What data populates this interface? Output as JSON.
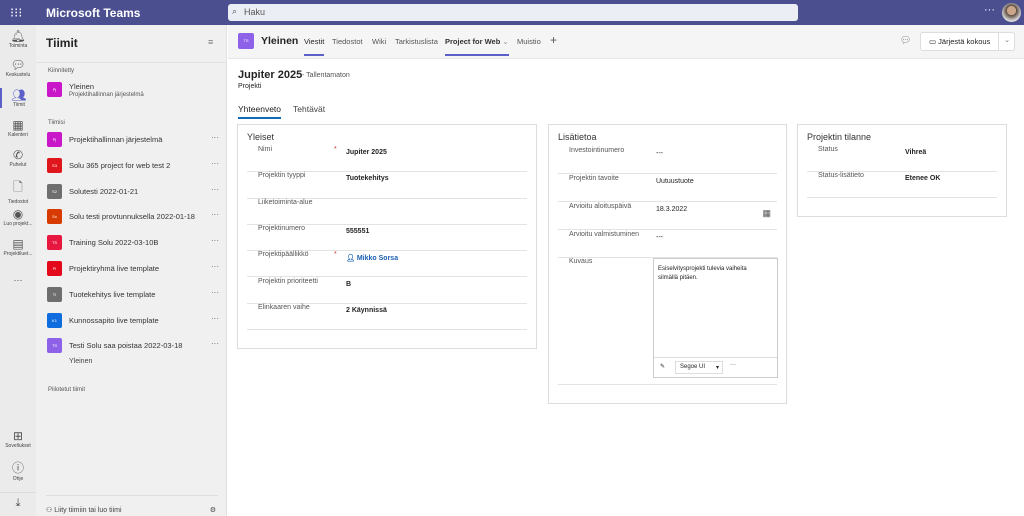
{
  "app": {
    "title": "Microsoft Teams",
    "search_placeholder": "Haku",
    "more": "···"
  },
  "rail": [
    {
      "label": "Toiminta",
      "icon": "bell"
    },
    {
      "label": "Keskustelu",
      "icon": "chat"
    },
    {
      "label": "Tiimit",
      "icon": "teams"
    },
    {
      "label": "Kalenteri",
      "icon": "calendar"
    },
    {
      "label": "Puhelut",
      "icon": "phone"
    },
    {
      "label": "Tiedostot",
      "icon": "file"
    },
    {
      "label": "Luo projekt...",
      "icon": "app"
    },
    {
      "label": "Projektiluet...",
      "icon": "app2"
    },
    {
      "label": "Sovellukset",
      "icon": "apps"
    },
    {
      "label": "Ohje",
      "icon": "help"
    }
  ],
  "teams_panel": {
    "title": "Tiimit",
    "pinned_label": "Kiinnitetty",
    "pinned": {
      "name": "Yleinen",
      "sub": "Projektihallinnan järjestelmä",
      "initials": "Pj",
      "color": "#c916c9"
    },
    "my_label": "Tiimisi",
    "teams": [
      {
        "initials": "Pj",
        "name": "Projektihallinnan järjestelmä",
        "color": "#c916c9"
      },
      {
        "initials": "S3",
        "name": "Solu 365 project for web test 2",
        "color": "#e0161d"
      },
      {
        "initials": "S2",
        "name": "Solutesti 2022-01-21",
        "color": "#6e6e6e"
      },
      {
        "initials": "Sx",
        "name": "Solu testi provtunnuksella 2022-01-18",
        "color": "#d83b01"
      },
      {
        "initials": "TS",
        "name": "Training Solu 2022-03-10B",
        "color": "#e81740"
      },
      {
        "initials": "PI",
        "name": "Projektiryhmä live template",
        "color": "#e3081a"
      },
      {
        "initials": "TI",
        "name": "Tuotekehitys live template",
        "color": "#6e6e6e"
      },
      {
        "initials": "K1",
        "name": "Kunnossapito live template",
        "color": "#0f6cde"
      },
      {
        "initials": "TS",
        "name": "Testi Solu saa poistaa 2022-03-18",
        "color": "#8e62e8"
      }
    ],
    "channel": "Yleinen",
    "hidden_label": "Piilotetut tiimit",
    "join": "Liity tiimiin tai luo tiimi"
  },
  "channel_header": {
    "badge": "TS",
    "name": "Yleinen",
    "tabs": [
      "Viestit",
      "Tiedostot",
      "Wiki",
      "Tarkistuslista",
      "Project for Web",
      "Muistio"
    ],
    "add": "+",
    "meet": "Järjestä kokous"
  },
  "project": {
    "title": "Jupiter 2025",
    "state": "- Tallentamaton",
    "type": "Projekti",
    "subtabs": [
      "Yhteenveto",
      "Tehtävät"
    ]
  },
  "general": {
    "title": "Yleiset",
    "fields": [
      {
        "label": "Nimi",
        "value": "Jupiter 2025",
        "required": "*"
      },
      {
        "label": "Projektin tyyppi",
        "value": "Tuotekehitys"
      },
      {
        "label": "Liiketoiminta-alue",
        "value": ""
      },
      {
        "label": "Projektinumero",
        "value": "555551"
      },
      {
        "label": "Projektipäällikkö",
        "value": "Mikko Sorsa",
        "required": "*"
      },
      {
        "label": "Projektin prioriteetti",
        "value": "B"
      },
      {
        "label": "Elinkaaren vaihe",
        "value": "2 Käynnissä"
      }
    ]
  },
  "extra": {
    "title": "Lisätietoa",
    "fields": [
      {
        "label": "Investointinumero",
        "value": "---"
      },
      {
        "label": "Projektin tavoite",
        "value": "Uutuustuote"
      },
      {
        "label": "Arvioitu aloituspäivä",
        "value": "18.3.2022"
      },
      {
        "label": "Arvioitu valmistuminen",
        "value": "---"
      }
    ],
    "desc_label": "Kuvaus",
    "desc": "Esiselvitysprojekti tulevia vaiheita silmällä pitäen.",
    "font": "Segoe UI",
    "more": "···"
  },
  "status": {
    "title": "Projektin tilanne",
    "fields": [
      {
        "label": "Status",
        "value": "Vihreä"
      },
      {
        "label": "Status-lisätieto",
        "value": "Etenee OK"
      }
    ]
  }
}
